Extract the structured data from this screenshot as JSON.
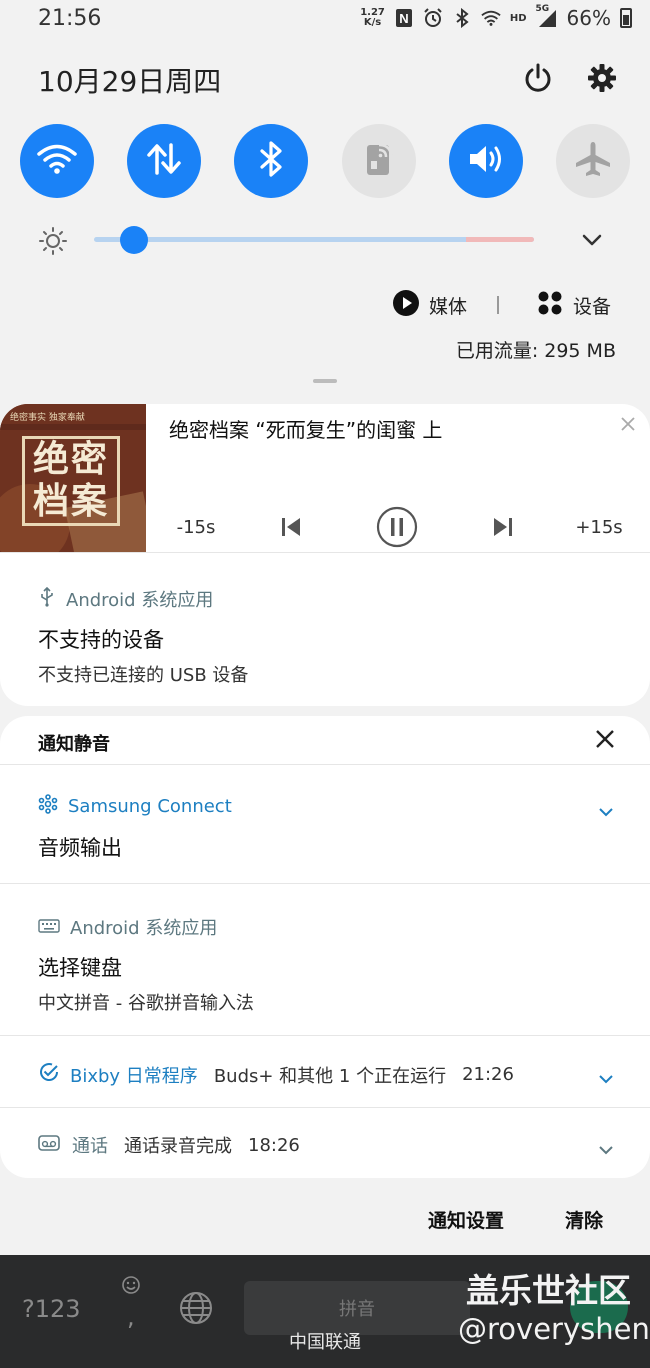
{
  "status_bar": {
    "time": "21:56",
    "net_speed_value": "1.27",
    "net_speed_unit": "K/s",
    "network_type": "HD",
    "cell_gen": "5G",
    "battery": "66%"
  },
  "header": {
    "date": "10月29日周四"
  },
  "quick_toggles": [
    {
      "name": "wifi",
      "on": true
    },
    {
      "name": "mobile-data",
      "on": true
    },
    {
      "name": "bluetooth",
      "on": true
    },
    {
      "name": "nfc",
      "on": false
    },
    {
      "name": "sound",
      "on": true
    },
    {
      "name": "airplane",
      "on": false
    }
  ],
  "brightness_level": 0.09,
  "panel": {
    "media_label": "媒体",
    "devices_label": "设备",
    "data_usage": "已用流量: 295 MB"
  },
  "media": {
    "title": "绝密档案 “死而复生”的闺蜜 上",
    "album_text": "绝密档案",
    "album_subtext": "绝密事实  独家奉献",
    "rewind": "-15s",
    "forward": "+15s"
  },
  "usb_notification": {
    "app": "Android 系统应用",
    "title": "不支持的设备",
    "body": "不支持已连接的 USB 设备"
  },
  "silent_section": {
    "heading": "通知静音",
    "samsung": {
      "app": "Samsung Connect",
      "title": "音频输出"
    },
    "keyboard": {
      "app": "Android 系统应用",
      "title": "选择键盘",
      "body": "中文拼音 - 谷歌拼音输入法"
    },
    "bixby": {
      "app": "Bixby 日常程序",
      "text": "Buds+ 和其他 1 个正在运行",
      "time": "21:26"
    },
    "call": {
      "app": "通话",
      "text": "通话录音完成",
      "time": "18:26"
    }
  },
  "footer": {
    "settings": "通知设置",
    "clear": "清除"
  },
  "keyboard_bg": {
    "sym": "?123",
    "comma": ",",
    "space": "拼音"
  },
  "carrier": "中国联通",
  "watermark": {
    "line1": "盖乐世社区",
    "line2": "@roveryshen"
  },
  "colors": {
    "accent": "#1a82f7",
    "app_label": "#5d7880",
    "samsung_blue": "#1d7fc1"
  }
}
